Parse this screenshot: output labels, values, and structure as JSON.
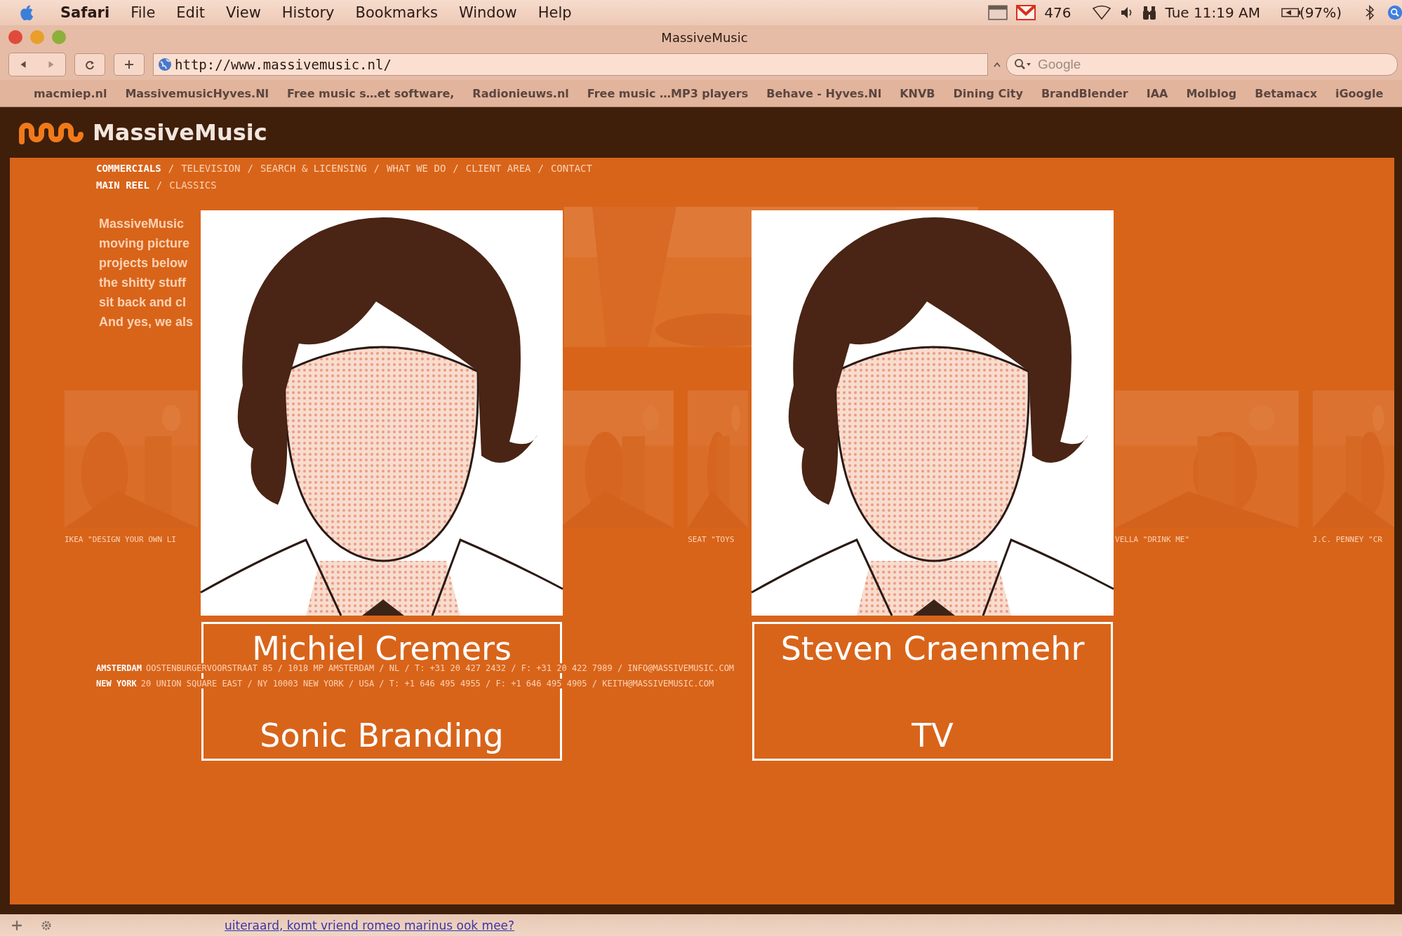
{
  "menubar": {
    "menus": [
      "Safari",
      "File",
      "Edit",
      "View",
      "History",
      "Bookmarks",
      "Window",
      "Help"
    ],
    "mail_count": "476",
    "clock": "Tue 11:19 AM",
    "battery": "(97%)"
  },
  "window": {
    "title": "MassiveMusic"
  },
  "toolbar": {
    "url": "http://www.massivemusic.nl/",
    "search": {
      "placeholder": "Google"
    }
  },
  "bookmarks": [
    "macmiep.nl",
    "MassivemusicHyves.Nl",
    "Free music s…et software,",
    "Radionieuws.nl",
    "Free music …MP3 players",
    "Behave - Hyves.Nl",
    "KNVB",
    "Dining City",
    "BrandBlender",
    "IAA",
    "Molblog",
    "Betamacx",
    "iGoogle"
  ],
  "site": {
    "logo": "MassiveMusic",
    "separator": "/",
    "nav": [
      {
        "label": "COMMERCIALS",
        "selected": true
      },
      {
        "label": "TELEVISION",
        "selected": false
      },
      {
        "label": "SEARCH & LICENSING",
        "selected": false
      },
      {
        "label": "WHAT WE DO",
        "selected": false
      },
      {
        "label": "CLIENT AREA",
        "selected": false
      },
      {
        "label": "CONTACT",
        "selected": false
      }
    ],
    "subnav": [
      {
        "label": "MAIN REEL",
        "selected": true
      },
      {
        "label": "CLASSICS",
        "selected": false
      }
    ],
    "intro_lines": [
      "MassiveMusic",
      "moving picture",
      "projects below",
      "the shitty stuff",
      "sit back and cl",
      "And yes, we als"
    ],
    "thumbnails": [
      {
        "kind": "picture",
        "caption": "IKEA \"DESIGN YOUR OWN LI"
      },
      {
        "kind": "picture"
      },
      {
        "kind": "picture",
        "caption": "SEAT \"TOYS"
      },
      {
        "kind": "picture",
        "caption": "VELLA \"DRINK ME\""
      },
      {
        "kind": "picture",
        "caption": "J.C. PENNEY \"CR"
      }
    ],
    "addresses": [
      {
        "city": "AMSTERDAM",
        "details": "OOSTENBURGERVOORSTRAAT 85 / 1018 MP AMSTERDAM / NL / T: +31 20 427 2432 / F: +31 20 422 7989 / INFO@MASSIVEMUSIC.COM"
      },
      {
        "city": "NEW YORK",
        "details": "20 UNION SQUARE EAST / NY 10003 NEW YORK / USA / T: +1 646 495 4955 / F: +1 646 495 4905 / KEITH@MASSIVEMUSIC.COM"
      }
    ]
  },
  "cards": [
    {
      "name": "Michiel Cremers",
      "role": "Sonic Branding"
    },
    {
      "name": "Steven Craenmehr",
      "role": "TV"
    }
  ],
  "status_bar": {
    "text": "uiteraard, komt vriend romeo marinus ook mee?"
  }
}
